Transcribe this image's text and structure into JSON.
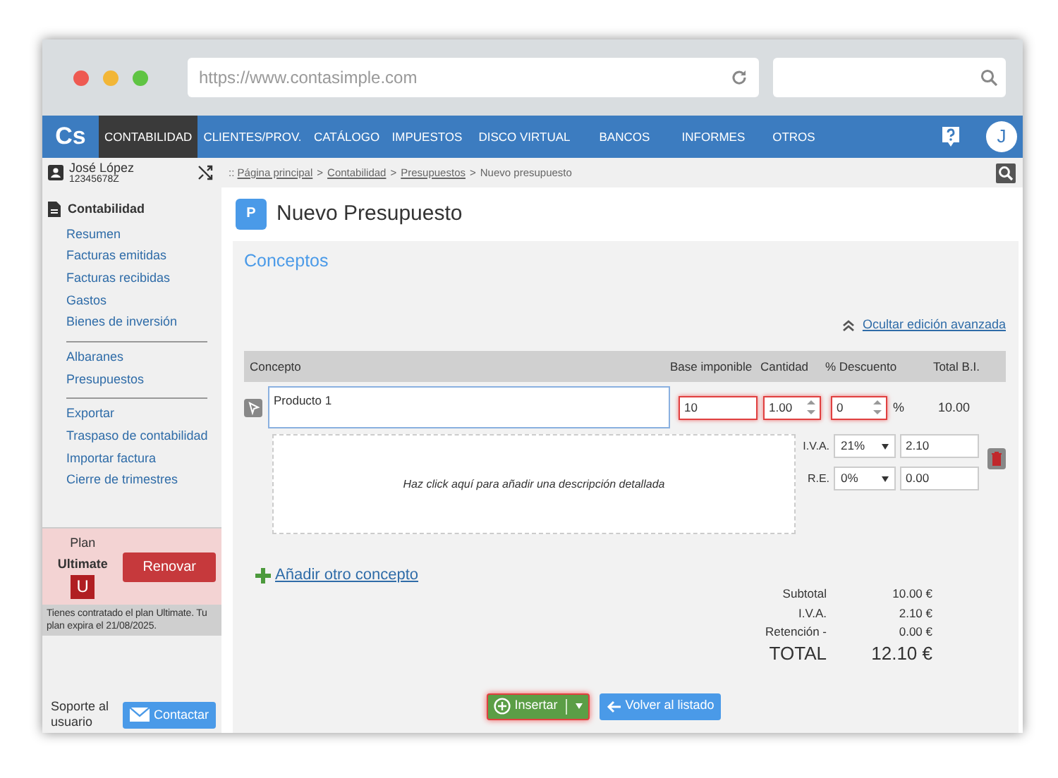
{
  "browser": {
    "url": "https://www.contasimple.com"
  },
  "navbar": {
    "logo": "Cs",
    "avatar": "J",
    "items": [
      {
        "label": "CONTABILIDAD",
        "selected": true
      },
      {
        "label": "CLIENTES/PROV.",
        "selected": false
      },
      {
        "label": "CATÁLOGO",
        "selected": false
      },
      {
        "label": "IMPUESTOS",
        "selected": false
      },
      {
        "label": "DISCO VIRTUAL",
        "selected": false
      },
      {
        "label": "BANCOS",
        "selected": false
      },
      {
        "label": "INFORMES",
        "selected": false
      },
      {
        "label": "OTROS",
        "selected": false
      }
    ]
  },
  "user": {
    "name": "José López",
    "id": "12345678Z"
  },
  "breadcrumb": {
    "prefix": "::",
    "separator": ">",
    "links": [
      "Página principal",
      "Contabilidad",
      "Presupuestos"
    ],
    "current": "Nuevo presupuesto"
  },
  "sidebar": {
    "section": "Contabilidad",
    "groups": [
      [
        "Resumen",
        "Facturas emitidas",
        "Facturas recibidas",
        "Gastos",
        "Bienes de inversión"
      ],
      [
        "Albaranes",
        "Presupuestos"
      ],
      [
        "Exportar",
        "Traspaso de contabilidad",
        "Importar factura",
        "Cierre de trimestres"
      ]
    ],
    "plan": {
      "label": "Plan",
      "name": "Ultimate",
      "badge": "U",
      "button": "Renovar",
      "note": "Tienes contratado el plan Ultimate. Tu plan expira el 21/08/2025."
    },
    "support": {
      "label": "Soporte al usuario",
      "button": "Contactar"
    }
  },
  "page": {
    "badge": "P",
    "title": "Nuevo Presupuesto",
    "section": "Conceptos",
    "toggle": "Ocultar edición avanzada",
    "columns": [
      "Concepto",
      "Base imponible",
      "Cantidad",
      "% Descuento",
      "Total B.I."
    ],
    "line": {
      "concept": "Producto 1",
      "base": {
        "value": "10",
        "invalid": true
      },
      "quantity": {
        "value": "1.00",
        "invalid": true
      },
      "discount": {
        "value": "0",
        "invalid": true
      },
      "percent": "%",
      "total": "10.00",
      "description": "Haz click aquí para añadir una descripción detallada",
      "taxes": [
        {
          "label": "I.V.A.",
          "rate": "21%",
          "amount": "2.10"
        },
        {
          "label": "R.E.",
          "rate": "0%",
          "amount": "0.00"
        }
      ]
    },
    "add": "Añadir otro concepto",
    "totals": [
      {
        "label": "Subtotal",
        "value": "10.00 €",
        "kind": "line"
      },
      {
        "label": "I.V.A.",
        "value": "2.10 €",
        "kind": "line"
      },
      {
        "label": "Retención -",
        "value": "0.00 €",
        "kind": "line"
      },
      {
        "label": "TOTAL",
        "value": "12.10 €",
        "kind": "grand"
      }
    ],
    "buttons": {
      "insert": "Insertar",
      "back": "Volver al listado"
    }
  }
}
